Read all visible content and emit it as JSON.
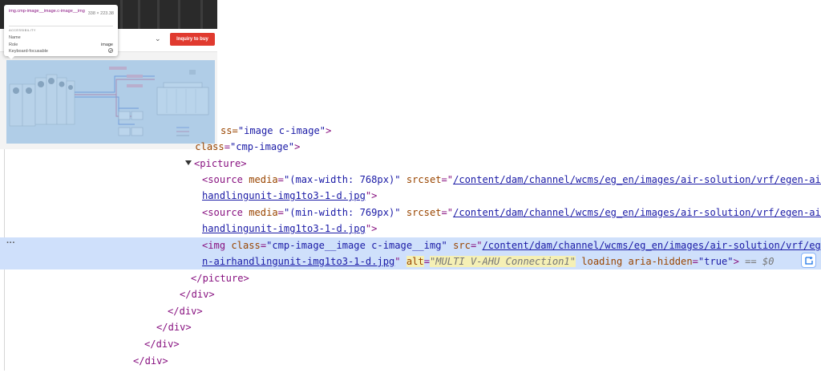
{
  "site": {
    "inquiry_label": "Inquiry to buy"
  },
  "tooltip": {
    "selector": "img.cmp-image__image.c-image__img",
    "size": "338 × 223.38",
    "section": "ACCESSIBILITY",
    "name_label": "Name",
    "name_value": "",
    "role_label": "Role",
    "role_value": "image",
    "keyboard_label": "Keyboard-focusable"
  },
  "code": {
    "l1_attr_tail": "ss=",
    "l1_val": "\"image c-image\"",
    "l2_class_attr": "class",
    "l2_val": "\"cmp-image\"",
    "picture_tag": "picture",
    "source_tag": "source",
    "media_attr": "media",
    "srcset_attr": "srcset",
    "media1": "\"(max-width: 768px)\"",
    "media2": "\"(min-width: 769px)\"",
    "srcset_a": "/content/dam/channel/wcms/eg_en/images/air-solution/vrf/egen-air",
    "srcset_b": "handlingunit-img1to3-1-d.jpg",
    "img_tag": "img",
    "class_attr": "class",
    "img_class": "\"cmp-image__image c-image__img\"",
    "src_attr": "src",
    "src_a": "/content/dam/channel/wcms/eg_en/images/air-solution/vrf/ege",
    "src_b": "n-airhandlingunit-img1to3-1-d.jpg",
    "alt_attr": "alt",
    "alt_val": "\"MULTI V-AHU Connection1\"",
    "loading_attr": "loading",
    "aria_attr": "aria-hidden",
    "aria_val": "\"true\"",
    "eq": "== $0",
    "close_picture": "picture",
    "close_div": "div"
  },
  "colors": {
    "tag": "#881280",
    "attr_name": "#994500",
    "attr_value": "#1a1aa6",
    "selected_row": "#cfe0fb",
    "inquiry_button": "#e03a2f"
  }
}
